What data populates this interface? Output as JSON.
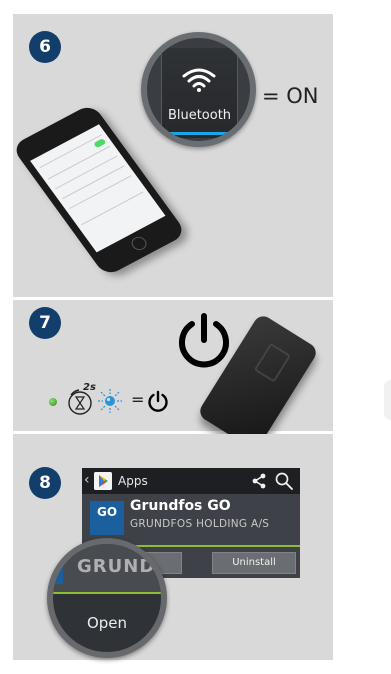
{
  "step6": {
    "number": "6",
    "bluetooth_label": "Bluetooth",
    "equals_on": "= ON",
    "wifi_icon": "wifi-icon"
  },
  "step7": {
    "number": "7",
    "timer_label": "2s",
    "equals": "=",
    "icons": [
      "green-led-icon",
      "hold-timer-icon",
      "blue-blink-icon",
      "power-icon"
    ]
  },
  "step8": {
    "number": "8",
    "store_title": "Apps",
    "app_icon_text": "GO",
    "app_name": "Grundfos GO",
    "developer": "GRUNDFOS HOLDING A/S",
    "uninstall_label": "Uninstall",
    "magnified_name": "GRUNDI",
    "open_label": "Open"
  },
  "colors": {
    "panel_bg": "#d9d9da",
    "badge": "#123e6b",
    "bluetooth_bar": "#1aa6e6",
    "store_accent": "#8bbf2d"
  }
}
